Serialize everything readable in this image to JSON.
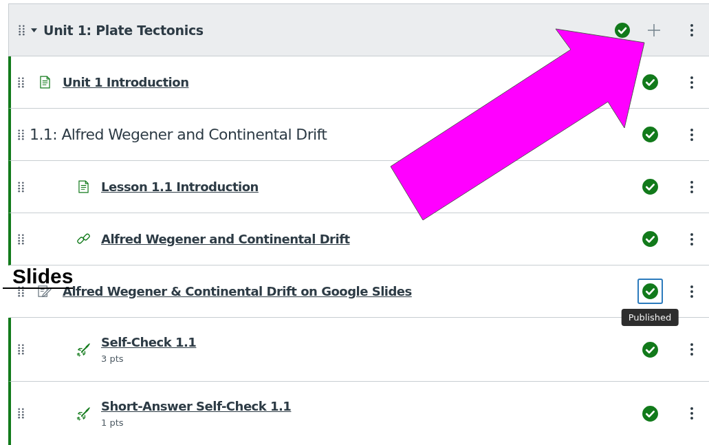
{
  "module": {
    "title": "Unit 1: Plate Tectonics",
    "expanded": true,
    "published": true
  },
  "items": [
    {
      "kind": "page",
      "title": "Unit 1 Introduction",
      "published": true,
      "focused": false
    },
    {
      "kind": "subheader",
      "title": "1.1: Alfred Wegener and Continental Drift",
      "published": true,
      "focused": false,
      "children": [
        {
          "kind": "page",
          "title": "Lesson 1.1 Introduction",
          "published": true,
          "focused": false
        },
        {
          "kind": "link",
          "title": "Alfred Wegener and Continental Drift",
          "published": true,
          "focused": false
        }
      ]
    },
    {
      "kind": "assignment",
      "title": "Alfred Wegener & Continental Drift on Google Slides",
      "published": true,
      "focused": true,
      "tooltip": "Published",
      "children": [
        {
          "kind": "quiz",
          "title": "Self-Check 1.1",
          "points": "3 pts",
          "published": true,
          "focused": false
        },
        {
          "kind": "quiz",
          "title": "Short-Answer Self-Check 1.1",
          "points": "1 pts",
          "published": true,
          "focused": false
        }
      ]
    }
  ],
  "overlay_label": "Slides"
}
